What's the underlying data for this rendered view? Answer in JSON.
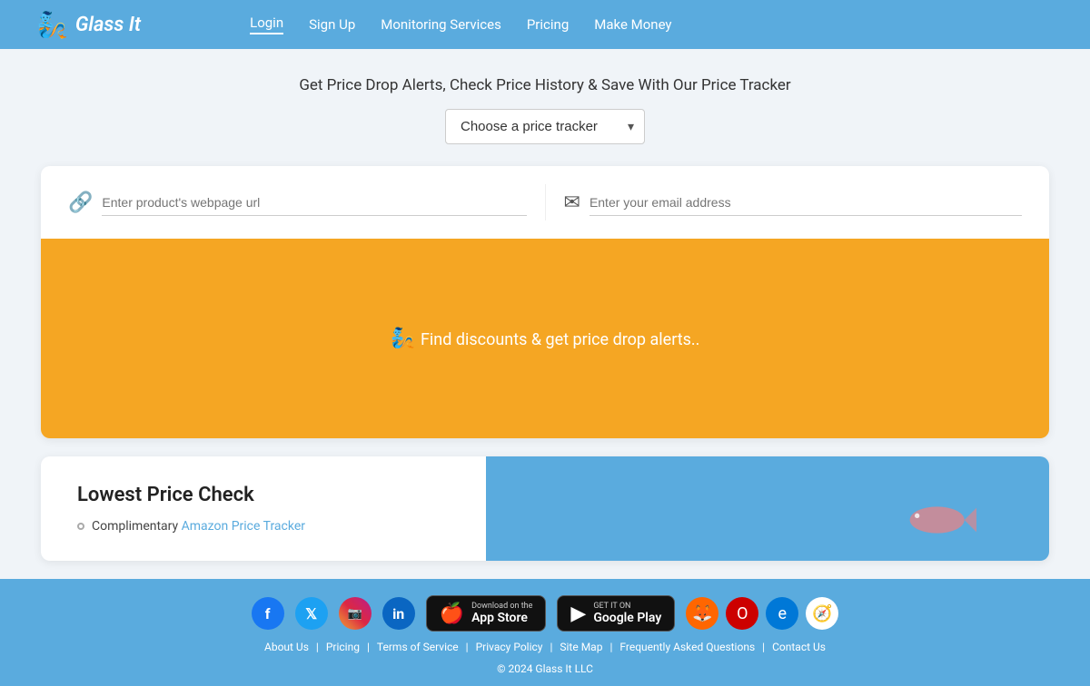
{
  "navbar": {
    "logo_text": "Glass It",
    "logo_icon": "🧞",
    "links": [
      {
        "label": "Login",
        "active": true
      },
      {
        "label": "Sign Up",
        "active": false
      },
      {
        "label": "Monitoring Services",
        "active": false
      },
      {
        "label": "Pricing",
        "active": false
      },
      {
        "label": "Make Money",
        "active": false
      }
    ]
  },
  "hero": {
    "headline": "Get Price Drop Alerts, Check Price History & Save With Our Price Tracker",
    "select_placeholder": "Choose a price tracker",
    "select_chevron": "▾"
  },
  "main_card": {
    "url_placeholder": "Enter product's webpage url",
    "url_icon": "🔗",
    "email_placeholder": "Enter your email address",
    "email_icon": "✉",
    "promo_emoji": "🧞",
    "promo_text": "Find discounts & get price drop alerts.."
  },
  "second_card": {
    "title": "Lowest Price Check",
    "items": [
      {
        "text": "Complimentary ",
        "link_text": "Amazon Price Tracker",
        "link": "#"
      }
    ]
  },
  "footer": {
    "social_icons": [
      {
        "name": "facebook",
        "label": "f"
      },
      {
        "name": "twitter",
        "label": "𝕏"
      },
      {
        "name": "instagram",
        "label": "📷"
      },
      {
        "name": "linkedin",
        "label": "in"
      }
    ],
    "app_store": {
      "small": "Download on the",
      "big": "App Store"
    },
    "google_play": {
      "small": "GET IT ON",
      "big": "Google Play"
    },
    "links": [
      "About Us",
      "Pricing",
      "Terms of Service",
      "Privacy Policy",
      "Site Map",
      "Frequently Asked Questions",
      "Contact Us"
    ],
    "copyright": "© 2024 Glass It LLC"
  }
}
